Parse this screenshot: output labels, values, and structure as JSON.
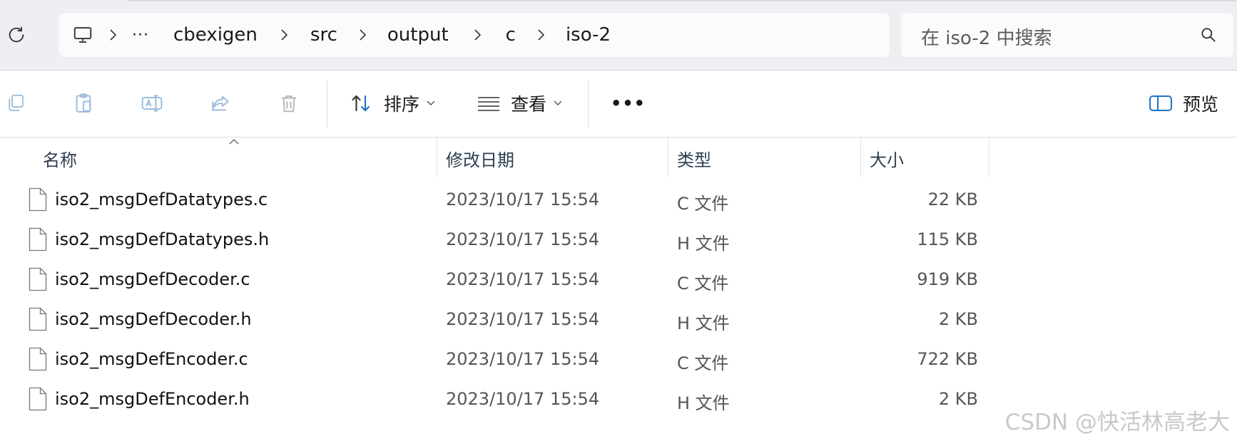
{
  "address": {
    "crumbs": [
      "cbexigen",
      "src",
      "output",
      "c",
      "iso-2"
    ],
    "ellipsis": "···"
  },
  "search": {
    "placeholder": "在 iso-2 中搜索"
  },
  "toolbar": {
    "sort_label": "排序",
    "view_label": "查看",
    "more_label": "•••",
    "preview_label": "预览"
  },
  "columns": {
    "name": "名称",
    "modified": "修改日期",
    "type": "类型",
    "size": "大小"
  },
  "files": [
    {
      "name": "iso2_msgDefDatatypes.c",
      "modified": "2023/10/17 15:54",
      "type": "C 文件",
      "size": "22 KB"
    },
    {
      "name": "iso2_msgDefDatatypes.h",
      "modified": "2023/10/17 15:54",
      "type": "H 文件",
      "size": "115 KB"
    },
    {
      "name": "iso2_msgDefDecoder.c",
      "modified": "2023/10/17 15:54",
      "type": "C 文件",
      "size": "919 KB"
    },
    {
      "name": "iso2_msgDefDecoder.h",
      "modified": "2023/10/17 15:54",
      "type": "H 文件",
      "size": "2 KB"
    },
    {
      "name": "iso2_msgDefEncoder.c",
      "modified": "2023/10/17 15:54",
      "type": "C 文件",
      "size": "722 KB"
    },
    {
      "name": "iso2_msgDefEncoder.h",
      "modified": "2023/10/17 15:54",
      "type": "H 文件",
      "size": "2 KB"
    }
  ],
  "watermark": "CSDN @快活林高老大",
  "colors": {
    "topbar_bg": "#eeeff2",
    "accent_blue": "#1a73c9"
  },
  "icons": [
    "refresh-icon",
    "computer-icon",
    "chevron-right-icon",
    "search-icon",
    "copy-icon",
    "paste-icon",
    "rename-icon",
    "share-icon",
    "delete-icon",
    "sort-icon",
    "view-icon",
    "preview-pane-icon",
    "file-icon"
  ]
}
